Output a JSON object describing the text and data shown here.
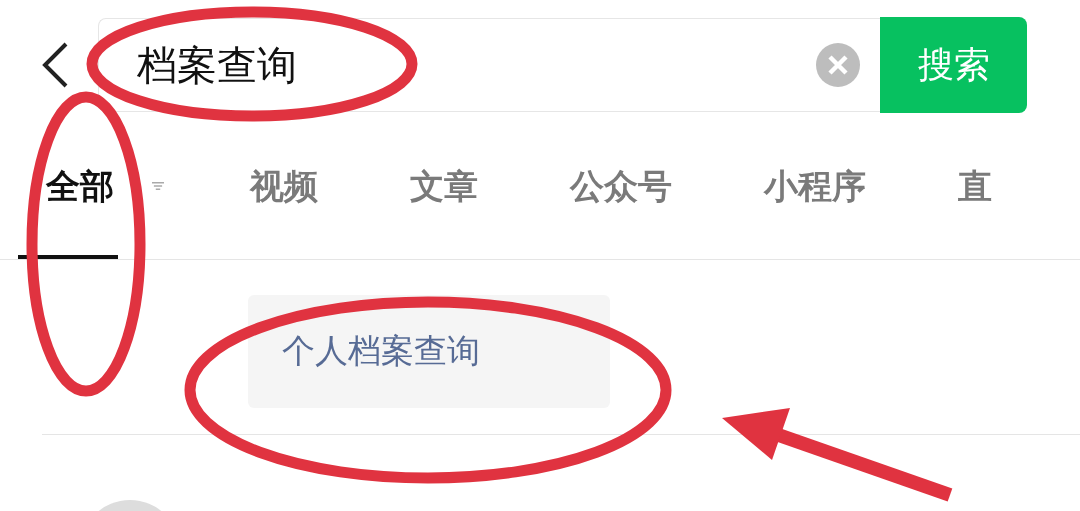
{
  "search": {
    "value": "档案查询",
    "button": "搜索"
  },
  "tabs": [
    {
      "label": "全部",
      "selected": true
    },
    {
      "label": "视频",
      "selected": false
    },
    {
      "label": "文章",
      "selected": false
    },
    {
      "label": "公众号",
      "selected": false
    },
    {
      "label": "小程序",
      "selected": false
    },
    {
      "label": "直",
      "selected": false
    }
  ],
  "suggestions": [
    "个人档案查询"
  ]
}
